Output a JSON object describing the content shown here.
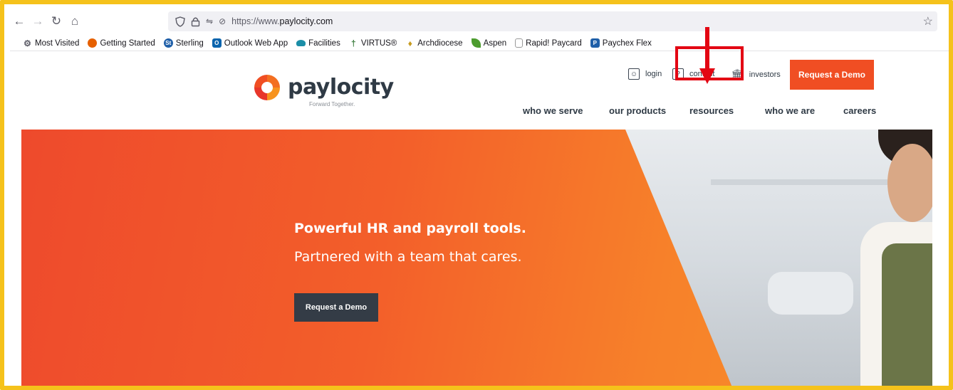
{
  "browser": {
    "url_prefix": "https://www.",
    "url_domain": "paylocity.com",
    "nav_icons": [
      "back-arrow-icon",
      "forward-arrow-icon",
      "reload-icon",
      "home-icon"
    ]
  },
  "bookmarks": [
    {
      "label": "Most Visited",
      "icon": "gear-icon",
      "color": "#5b5b66"
    },
    {
      "label": "Getting Started",
      "icon": "firefox-icon",
      "color": "#e66000"
    },
    {
      "label": "Sterling",
      "icon": "sterling-icon",
      "color": "#1f5fa8"
    },
    {
      "label": "Outlook Web App",
      "icon": "outlook-icon",
      "color": "#0a64ad"
    },
    {
      "label": "Facilities",
      "icon": "cloud-icon",
      "color": "#1b8ea7"
    },
    {
      "label": "VIRTUS®",
      "icon": "virtus-icon",
      "color": "#3c7d3e"
    },
    {
      "label": "Archdiocese",
      "icon": "archdiocese-icon",
      "color": "#c79b1f"
    },
    {
      "label": "Aspen",
      "icon": "leaf-icon",
      "color": "#4d9c2f"
    },
    {
      "label": "Rapid! Paycard",
      "icon": "page-icon",
      "color": "#9a9a9a"
    },
    {
      "label": "Paychex Flex",
      "icon": "paychex-icon",
      "color": "#1f5fa8"
    }
  ],
  "site": {
    "logo_text": "paylocity",
    "tagline": "Forward Together.",
    "util_links": {
      "login": "login",
      "contact": "contact",
      "investors": "investors"
    },
    "request_demo_top": "Request a Demo",
    "nav": {
      "who_we_serve": "who we serve",
      "our_products": "our products",
      "resources": "resources",
      "who_we_are": "who we are",
      "careers": "careers"
    },
    "colors": {
      "brand_orange": "#f04e23",
      "dark_navy": "#343c46",
      "annotation_red": "#e30613"
    }
  },
  "hero": {
    "title": "Powerful HR and payroll tools.",
    "subtitle": "Partnered with a team that cares.",
    "cta": "Request a Demo"
  }
}
